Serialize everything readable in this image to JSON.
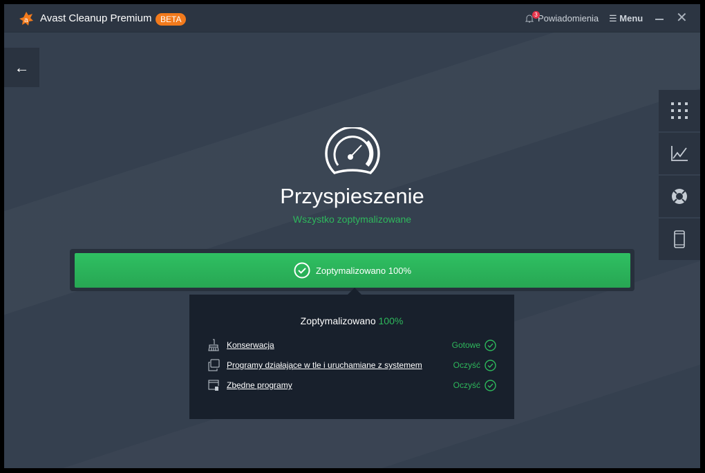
{
  "app": {
    "title": "Avast Cleanup Premium",
    "badge": "BETA"
  },
  "header": {
    "notifications_label": "Powiadomienia",
    "notifications_count": "3",
    "menu_label": "Menu"
  },
  "main": {
    "title": "Przyspieszenie",
    "subtitle": "Wszystko zoptymalizowane",
    "progress_label": "Zoptymalizowano 100%",
    "progress_value": 100
  },
  "panel": {
    "title_prefix": "Zoptymalizowano",
    "title_value": "100%",
    "items": [
      {
        "label": "Konserwacja",
        "status": "Gotowe"
      },
      {
        "label": "Programy działające w tle i uruchamiane z systemem",
        "status": "Oczyść"
      },
      {
        "label": "Zbędne programy",
        "status": "Oczyść"
      }
    ]
  },
  "colors": {
    "accent": "#2eb85c",
    "brand": "#f27a1c"
  }
}
